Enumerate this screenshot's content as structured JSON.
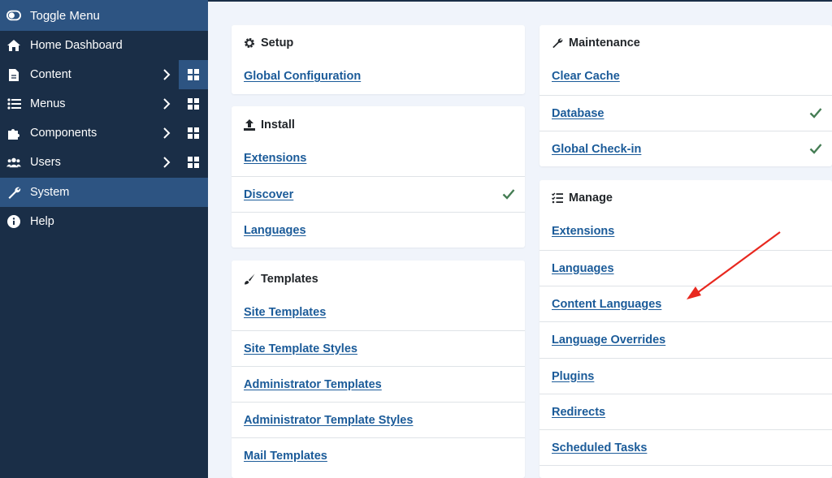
{
  "sidebar": {
    "toggle_label": "Toggle Menu",
    "items": [
      {
        "label": "Home Dashboard",
        "icon": "home-icon"
      },
      {
        "label": "Content",
        "icon": "file-icon"
      },
      {
        "label": "Menus",
        "icon": "list-icon"
      },
      {
        "label": "Components",
        "icon": "puzzle-icon"
      },
      {
        "label": "Users",
        "icon": "users-icon"
      },
      {
        "label": "System",
        "icon": "wrench-icon"
      },
      {
        "label": "Help",
        "icon": "info-icon"
      }
    ]
  },
  "cards": {
    "setup": {
      "title": "Setup",
      "icon": "gear-icon",
      "links": [
        "Global Configuration"
      ]
    },
    "install": {
      "title": "Install",
      "icon": "upload-icon",
      "links": [
        "Extensions",
        "Discover",
        "Languages"
      ]
    },
    "templates": {
      "title": "Templates",
      "icon": "brush-icon",
      "links": [
        "Site Templates",
        "Site Template Styles",
        "Administrator Templates",
        "Administrator Template Styles",
        "Mail Templates"
      ]
    },
    "maintenance": {
      "title": "Maintenance",
      "icon": "wrench-icon",
      "links": [
        "Clear Cache",
        "Database",
        "Global Check-in"
      ]
    },
    "manage": {
      "title": "Manage",
      "icon": "checklist-icon",
      "links": [
        "Extensions",
        "Languages",
        "Content Languages",
        "Language Overrides",
        "Plugins",
        "Redirects",
        "Scheduled Tasks"
      ]
    }
  },
  "colors": {
    "sidebar_bg": "#1a2e47",
    "active_bg": "#2d5482",
    "link": "#1b5b99",
    "check": "#457d54",
    "arrow": "#e8281f"
  }
}
